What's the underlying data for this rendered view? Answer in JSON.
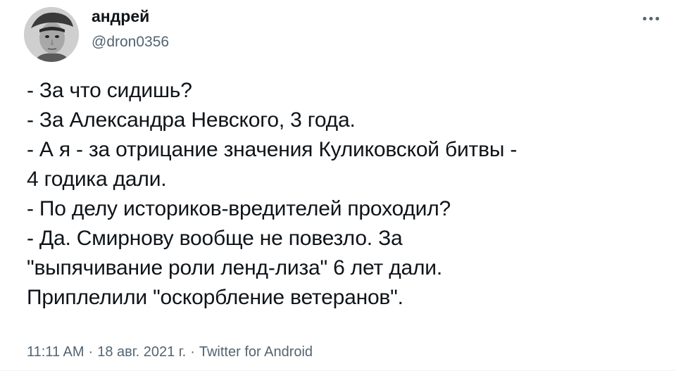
{
  "author": {
    "display_name": "андрей",
    "handle": "@dron0356",
    "avatar_icon": "user-avatar-photo"
  },
  "more_icon": "more-horizontal-icon",
  "tweet": {
    "lines": [
      "- За что сидишь?",
      "- За Александра Невского, 3 года.",
      "- А я - за отрицание значения Куликовской битвы -",
      "4 годика дали.",
      "- По делу историков-вредителей проходил?",
      "- Да. Смирнову вообще не повезло. За",
      "\"выпячивание роли ленд-лиза\" 6 лет дали.",
      "Приплелили \"оскорбление ветеранов\"."
    ]
  },
  "meta": {
    "time": "11:11 AM",
    "separator": "·",
    "date": "18 авг. 2021 г.",
    "source": "Twitter for Android"
  },
  "colors": {
    "text": "#0f1419",
    "secondary": "#536471"
  }
}
